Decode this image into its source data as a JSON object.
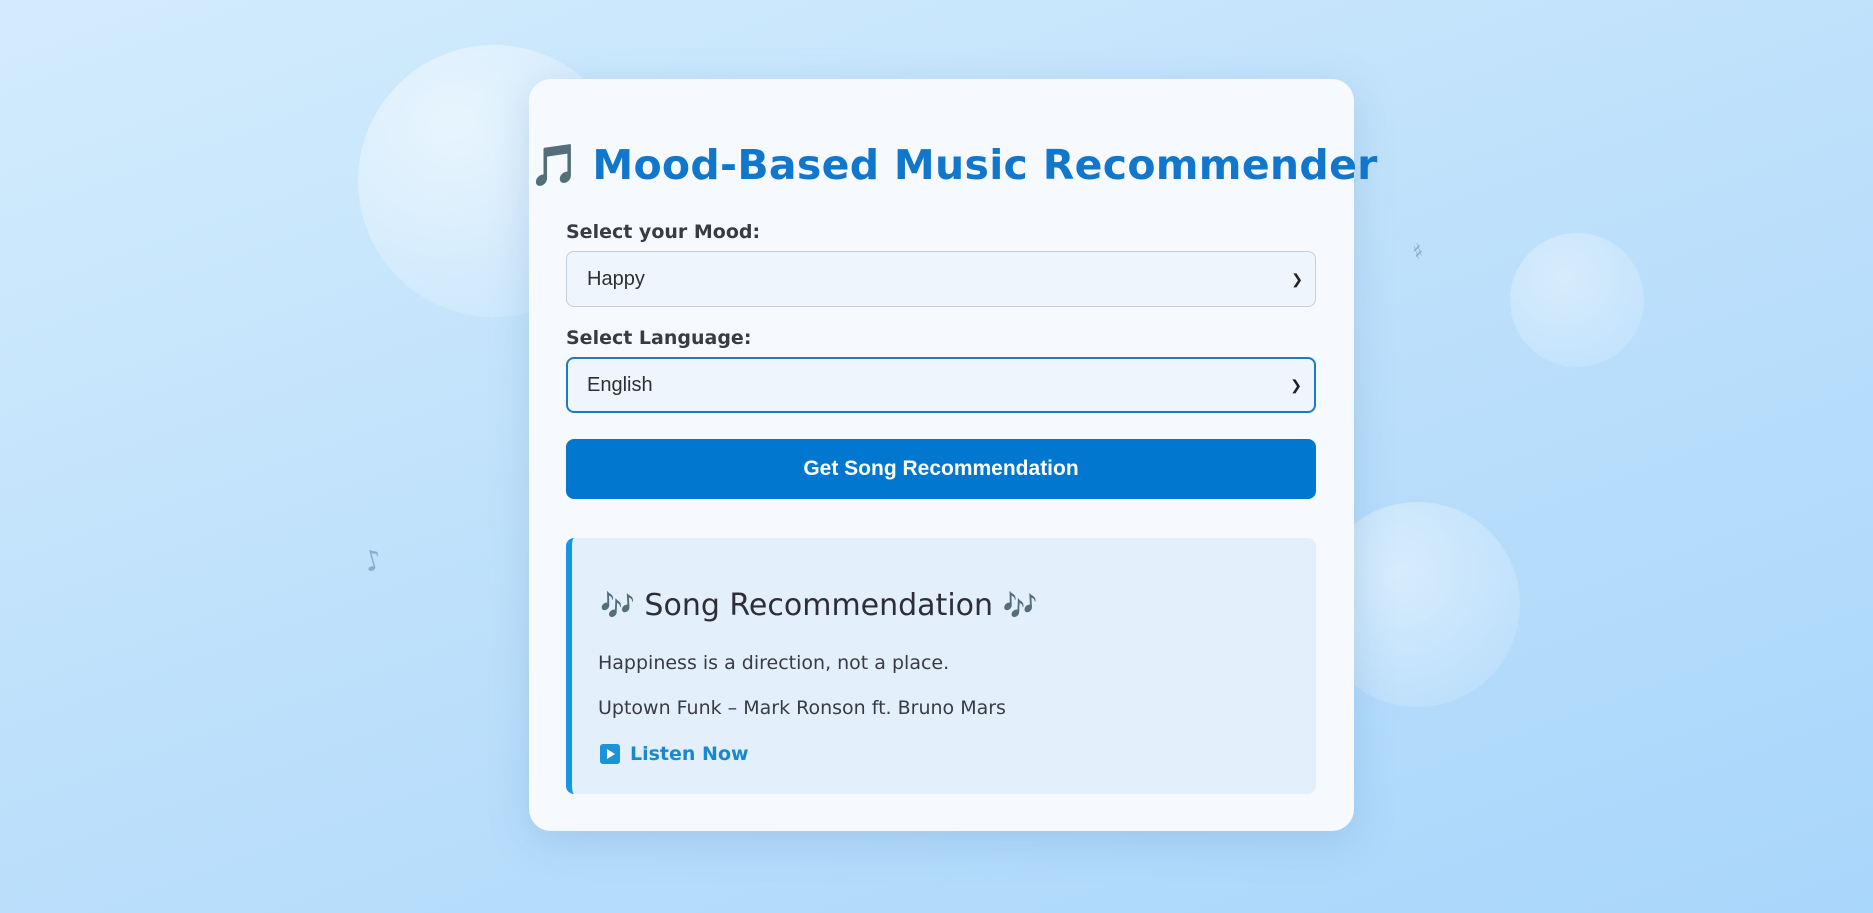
{
  "page": {
    "title_icon": "🎵",
    "title": "Mood-Based Music Recommender"
  },
  "form": {
    "mood_label": "Select your Mood:",
    "mood_selected": "Happy",
    "language_label": "Select Language:",
    "language_selected": "English",
    "submit_label": "Get Song Recommendation"
  },
  "result": {
    "title_icon": "🎶",
    "title": "Song Recommendation",
    "quote": "Happiness is a direction, not a place.",
    "song": "Uptown Funk – Mark Ronson ft. Bruno Mars",
    "listen_label": "Listen Now"
  },
  "decorations": {
    "note_left": "♪",
    "note_right": "♯"
  },
  "colors": {
    "accent": "#0277cf",
    "title": "#1177cc",
    "result_border": "#1597e6",
    "link": "#1888d0"
  }
}
